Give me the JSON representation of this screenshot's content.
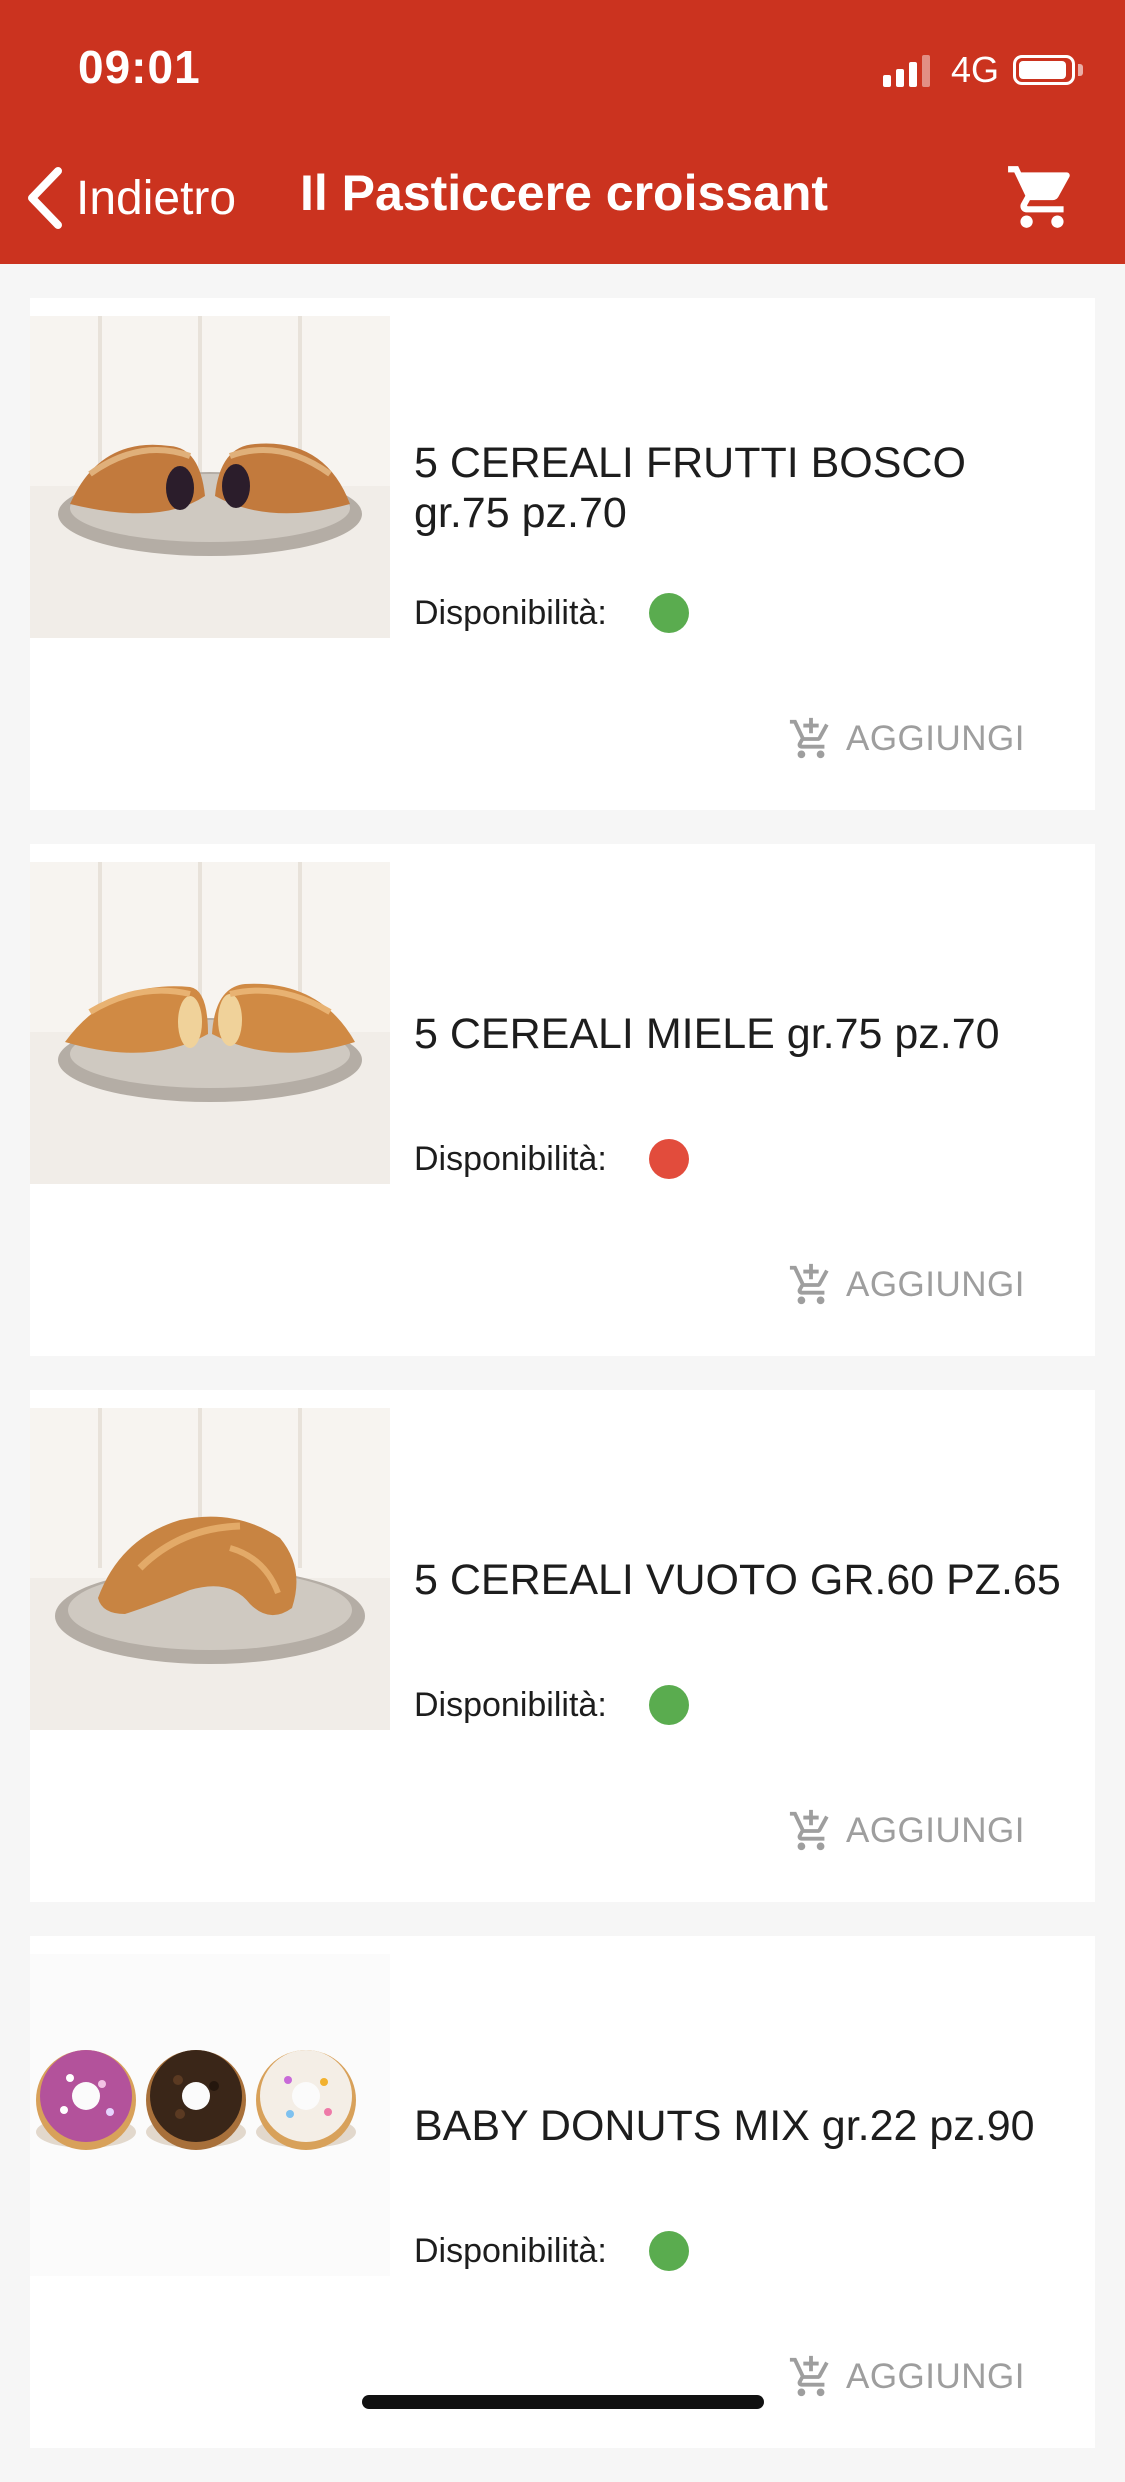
{
  "status_bar": {
    "time": "09:01",
    "network": "4G",
    "battery_level": 0.95
  },
  "nav": {
    "back_label": "Indietro",
    "title": "Il Pasticcere croissant",
    "cart_icon": "cart-icon"
  },
  "colors": {
    "brand": "#cb331f",
    "available": "#5aac4f",
    "unavailable": "#e24c3c",
    "action": "#9e9e9e"
  },
  "products": [
    {
      "name": "5 CEREALI FRUTTI BOSCO gr.75 pz.70",
      "availability_label": "Disponibilità:",
      "available": true,
      "add_label": "AGGIUNGI",
      "image": "croissant-berries-photo"
    },
    {
      "name": "5 CEREALI MIELE gr.75 pz.70",
      "availability_label": "Disponibilità:",
      "available": false,
      "add_label": "AGGIUNGI",
      "image": "croissant-honey-photo"
    },
    {
      "name": "5 CEREALI VUOTO GR.60 PZ.65",
      "availability_label": "Disponibilità:",
      "available": true,
      "add_label": "AGGIUNGI",
      "image": "croissant-plain-photo"
    },
    {
      "name": "BABY DONUTS MIX gr.22 pz.90",
      "availability_label": "Disponibilità:",
      "available": true,
      "add_label": "AGGIUNGI",
      "image": "donuts-mix-photo"
    }
  ]
}
